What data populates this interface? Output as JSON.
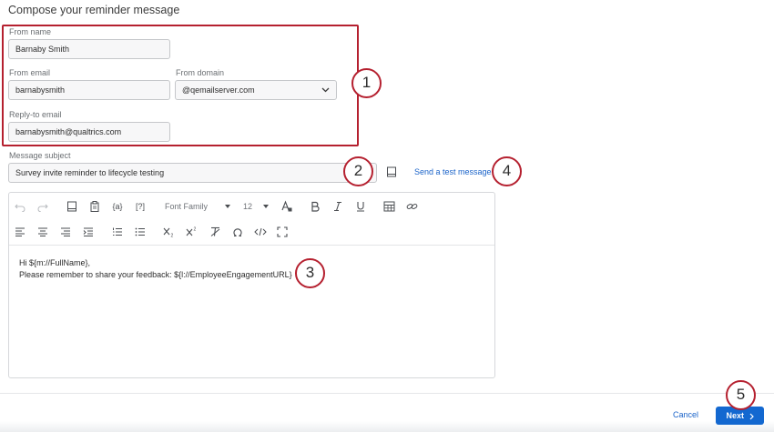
{
  "page": {
    "title": "Compose your reminder message"
  },
  "sender": {
    "from_name_label": "From name",
    "from_name_value": "Barnaby Smith",
    "from_email_label": "From email",
    "from_email_value": "barnabysmith",
    "from_domain_label": "From domain",
    "from_domain_value": "@qemailserver.com",
    "reply_to_label": "Reply-to email",
    "reply_to_value": "barnabysmith@qualtrics.com"
  },
  "subject": {
    "label": "Message subject",
    "value": "Survey invite reminder to lifecycle testing",
    "test_message_link": "Send a test message"
  },
  "editor": {
    "font_family": "Font Family",
    "font_size": "12",
    "piped_text_icon": "{a}",
    "help_icon": "[?]",
    "lines": [
      "Hi ${m://FullName},",
      "Please remember to share your feedback: ${l://EmployeeEngagementURL}"
    ]
  },
  "callouts": [
    "1",
    "2",
    "3",
    "4",
    "5"
  ],
  "footer": {
    "cancel_label": "Cancel",
    "next_label": "Next"
  },
  "colors": {
    "accent": "#b5202f",
    "primary": "#1368d0",
    "link": "#1a63c9"
  }
}
